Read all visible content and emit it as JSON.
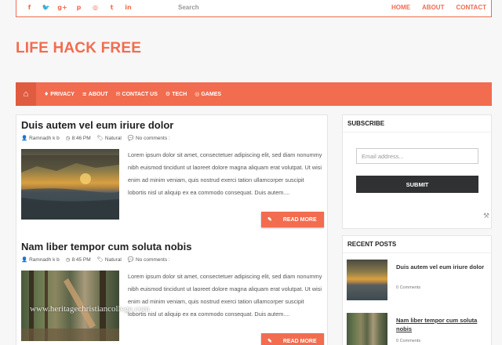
{
  "topbar": {
    "social": [
      {
        "icon": "facebook-icon",
        "glyph": "f"
      },
      {
        "icon": "twitter-icon",
        "glyph": "🐦"
      },
      {
        "icon": "google-plus-icon",
        "glyph": "g+"
      },
      {
        "icon": "pinterest-icon",
        "glyph": "p"
      },
      {
        "icon": "instagram-icon",
        "glyph": "◎"
      },
      {
        "icon": "tumblr-icon",
        "glyph": "t"
      },
      {
        "icon": "linkedin-icon",
        "glyph": "in"
      }
    ],
    "search_placeholder": "Search",
    "menu": [
      "HOME",
      "ABOUT",
      "CONTACT"
    ]
  },
  "site_title": "LIFE HACK FREE",
  "nav": {
    "home_icon": "⌂",
    "items": [
      {
        "icon": "lightbulb-icon",
        "glyph": "♦",
        "label": "PRIVACY"
      },
      {
        "icon": "list-icon",
        "glyph": "≡",
        "label": "ABOUT"
      },
      {
        "icon": "envelope-icon",
        "glyph": "✉",
        "label": "CONTACT US"
      },
      {
        "icon": "gear-icon",
        "glyph": "⚙",
        "label": "TECH"
      },
      {
        "icon": "gamepad-icon",
        "glyph": "◎",
        "label": "GAMES"
      }
    ]
  },
  "posts": [
    {
      "title": "Duis autem vel eum iriure dolor",
      "author": "Ramnadh k b",
      "time": "8:46 PM",
      "label": "Natural",
      "comments": "No comments :",
      "excerpt": "Lorem ipsum dolor sit amet, consectetuer adipiscing elit, sed diam nonummy nibh euismod tincidunt ut laoreet dolore magna aliquam erat volutpat. Ut wisi enim ad minim veniam, quis nostrud exerci tation ullamcorper suscipit lobortis nisl ut aliquip ex ea commodo consequat. Duis autem....",
      "read_more": "READ MORE"
    },
    {
      "title": "Nam liber tempor cum soluta nobis",
      "author": "Ramnadh k b",
      "time": "8:45 PM",
      "label": "Natural",
      "comments": "No comments :",
      "excerpt": "Lorem ipsum dolor sit amet, consectetuer adipiscing elit, sed diam nonummy nibh euismod tincidunt ut laoreet dolore magna aliquam erat volutpat. Ut wisi enim ad minim veniam, quis nostrud exerci tation ullamcorper suscipit lobortis nisl ut aliquip ex ea commodo consequat. Duis autem....",
      "read_more": "READ MORE",
      "watermark": "www.heritagechristiancollege.com"
    }
  ],
  "subscribe": {
    "title": "SUBSCRIBE",
    "email_placeholder": "Email address...",
    "submit": "SUBMIT"
  },
  "recent": {
    "title": "RECENT POSTS",
    "items": [
      {
        "title": "Duis autem vel eum iriure dolor",
        "comments": "0 Comments"
      },
      {
        "title": "Nam liber tempor cum soluta nobis",
        "comments": "0 Comments"
      }
    ]
  },
  "colors": {
    "accent": "#f26c4f",
    "dark_button": "#2f3132"
  }
}
